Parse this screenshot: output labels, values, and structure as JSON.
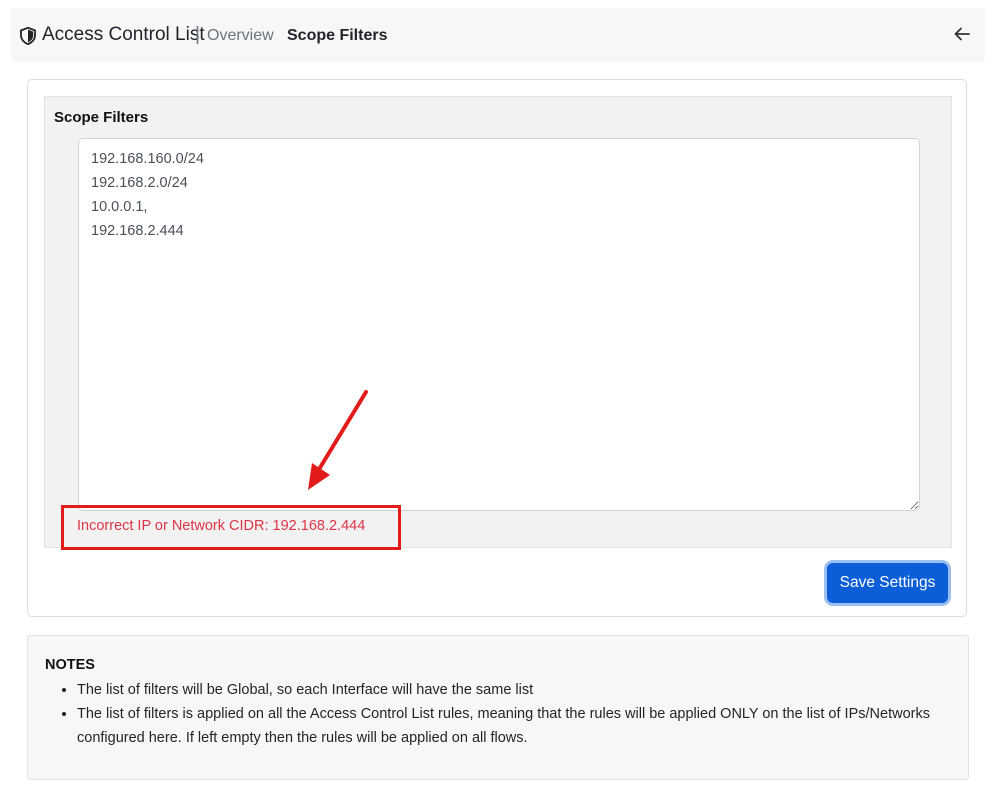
{
  "header": {
    "title": "Access Control List",
    "separator": "|",
    "breadcrumb_overview": "Overview",
    "breadcrumb_active": "Scope Filters",
    "shield_icon": "shield-icon",
    "back_icon": "arrow-left-icon"
  },
  "panel": {
    "title": "Scope Filters",
    "filters_value": "192.168.160.0/24\n192.168.2.0/24\n10.0.0.1,\n192.168.2.444",
    "error_message": "Incorrect IP or Network CIDR: 192.168.2.444"
  },
  "actions": {
    "save_label": "Save Settings"
  },
  "notes": {
    "title": "NOTES",
    "items": [
      "The list of filters will be Global, so each Interface will have the same list",
      "The list of filters is applied on all the Access Control List rules, meaning that the rules will be applied ONLY on the list of IPs/Networks configured here. If left empty then the rules will be applied on all flows."
    ]
  },
  "colors": {
    "error": "#dc3545",
    "primary": "#0b5ed7",
    "annotation": "#e21b1b"
  }
}
